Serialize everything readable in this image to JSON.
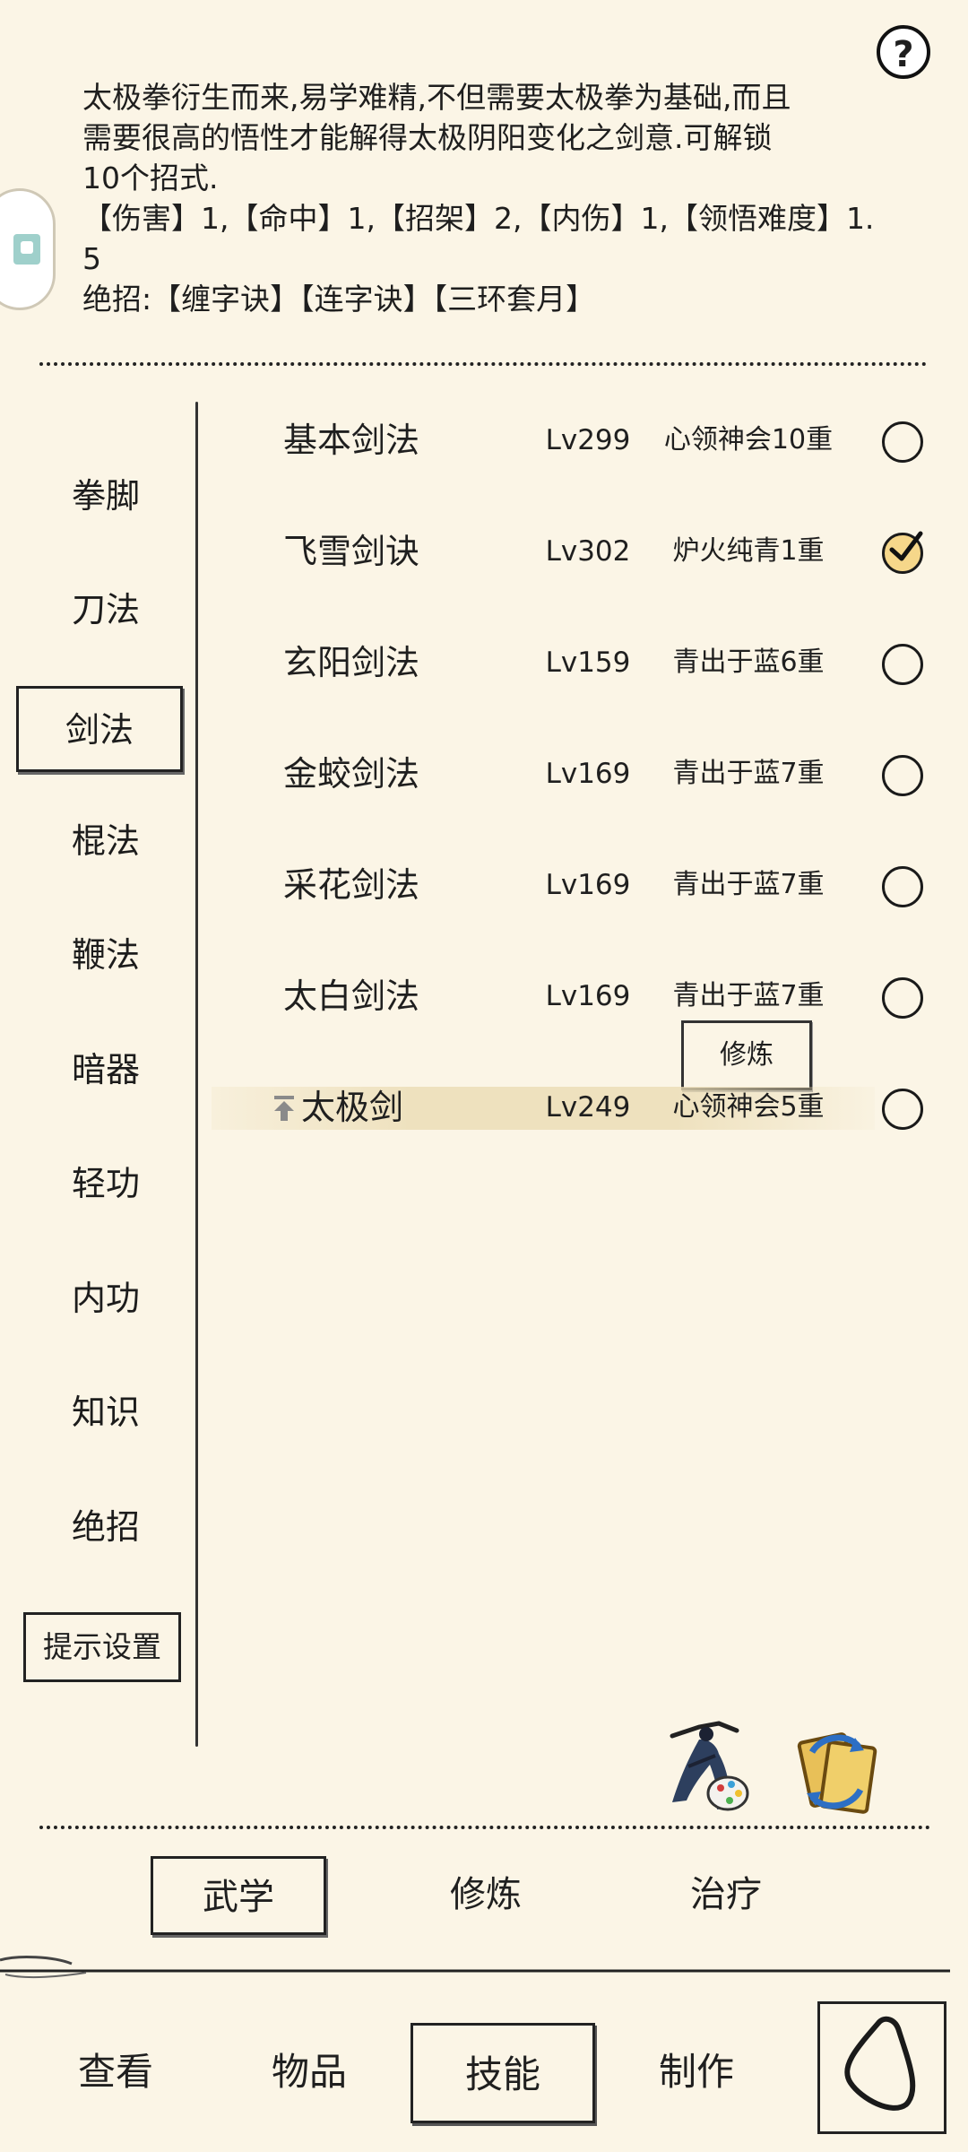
{
  "description": {
    "lines": [
      "太极拳衍生而来,易学难精,不但需要太极拳为基础,而且",
      "需要很高的悟性才能解得太极阴阳变化之剑意.可解锁",
      "10个招式.",
      "  【伤害】1,【命中】1,【招架】2,【内伤】1,【领悟难度】1.",
      "5",
      "绝招:【缠字诀】【连字诀】【三环套月】"
    ]
  },
  "help_button": "?",
  "categories": [
    "拳脚",
    "刀法",
    "剑法",
    "棍法",
    "鞭法",
    "暗器",
    "轻功",
    "内功",
    "知识",
    "绝招"
  ],
  "active_category": "剑法",
  "tip_settings_label": "提示设置",
  "skills": [
    {
      "name": "基本剑法",
      "level": "Lv299",
      "rank": "心领神会10重",
      "selected": false
    },
    {
      "name": "飞雪剑诀",
      "level": "Lv302",
      "rank": "炉火纯青1重",
      "selected": true
    },
    {
      "name": "玄阳剑法",
      "level": "Lv159",
      "rank": "青出于蓝6重",
      "selected": false
    },
    {
      "name": "金蛟剑法",
      "level": "Lv169",
      "rank": "青出于蓝7重",
      "selected": false
    },
    {
      "name": "采花剑法",
      "level": "Lv169",
      "rank": "青出于蓝7重",
      "selected": false
    },
    {
      "name": "太白剑法",
      "level": "Lv169",
      "rank": "青出于蓝7重",
      "selected": false
    },
    {
      "name": "太极剑",
      "level": "Lv249",
      "rank": "心领神会5重",
      "selected": false,
      "highlighted": true,
      "upgradable": true
    }
  ],
  "train_button": "修炼",
  "subtabs": [
    "武学",
    "修炼",
    "治疗"
  ],
  "active_subtab": "武学",
  "bottom_nav": [
    "查看",
    "物品",
    "技能",
    "制作"
  ],
  "active_nav": "技能",
  "colors": {
    "background": "#fbf5e6",
    "checked_fill": "#f6d78a",
    "ink": "#1f1f1f"
  }
}
